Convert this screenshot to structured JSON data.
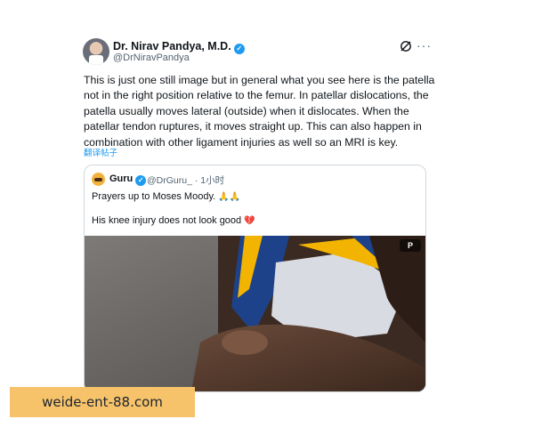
{
  "tweet": {
    "author_name": "Dr. Nirav Pandya, M.D.",
    "author_handle": "@DrNiravPandya",
    "text": "This is just one still image but in general what you see here is the patella not in the right position relative to the femur. In patellar dislocations, the patella usually moves lateral (outside) when it dislocates.  When the patellar tendon ruptures, it moves straight up.  This can also happen in combination with other ligament injuries as well so an MRI is key.",
    "translate_label": "翻译帖子",
    "icons": [
      "grok-icon",
      "more-icon",
      "verified-badge-icon"
    ]
  },
  "quote": {
    "author_name": "Guru",
    "author_handle": "@DrGuru_",
    "time": "· 1小时",
    "line1": "Prayers up to Moses Moody.",
    "line1_emoji": "🙏🙏",
    "line2": "His knee injury does not look good",
    "line2_emoji": "💔",
    "image_badge": "P"
  },
  "watermark": {
    "text": "weide-ent-88.com"
  },
  "colors": {
    "accent": "#1d9bf0",
    "secondary_text": "#536471",
    "border": "#cfd9de",
    "watermark_bg": "#f6c36a",
    "jersey_blue": "#1d428a",
    "jersey_gold": "#f2b400"
  }
}
